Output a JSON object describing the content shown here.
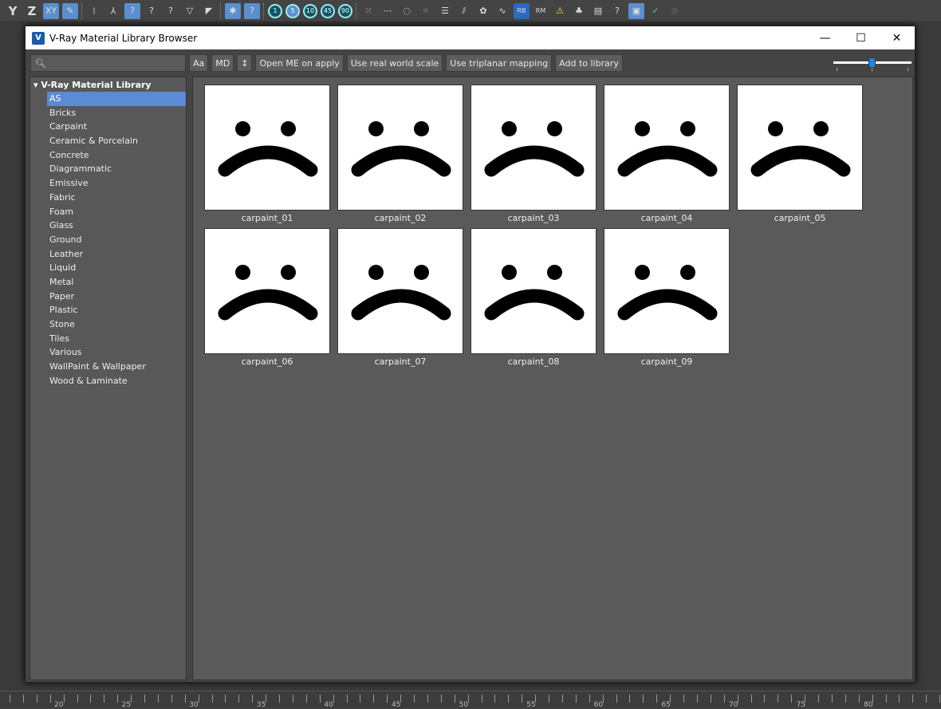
{
  "top_toolbar": {
    "axis_y": "Y",
    "axis_z": "Z",
    "xy": "XY",
    "snaps": [
      "1",
      "5",
      "10",
      "45",
      "90"
    ]
  },
  "window": {
    "title": "V-Ray Material Library Browser",
    "minimize": "—",
    "maximize": "☐",
    "close": "✕"
  },
  "toolbar": {
    "search_placeholder": "",
    "aa": "Aa",
    "md": "MD",
    "sort": "↕",
    "open_me": "Open ME on apply",
    "real_world": "Use real world scale",
    "triplanar": "Use triplanar mapping",
    "add": "Add to library"
  },
  "tree": {
    "root": "V-Ray Material Library",
    "items": [
      "AS",
      "Bricks",
      "Carpaint",
      "Ceramic & Porcelain",
      "Concrete",
      "Diagrammatic",
      "Emissive",
      "Fabric",
      "Foam",
      "Glass",
      "Ground",
      "Leather",
      "Liquid",
      "Metal",
      "Paper",
      "Plastic",
      "Stone",
      "Tiles",
      "Various",
      "WallPaint & Wallpaper",
      "Wood & Laminate"
    ],
    "selected": "AS"
  },
  "materials": [
    "carpaint_01",
    "carpaint_02",
    "carpaint_03",
    "carpaint_04",
    "carpaint_05",
    "carpaint_06",
    "carpaint_07",
    "carpaint_08",
    "carpaint_09"
  ],
  "ruler": [
    "20",
    "25",
    "30",
    "35",
    "40",
    "45",
    "50",
    "55",
    "60",
    "65",
    "70",
    "75",
    "80"
  ]
}
